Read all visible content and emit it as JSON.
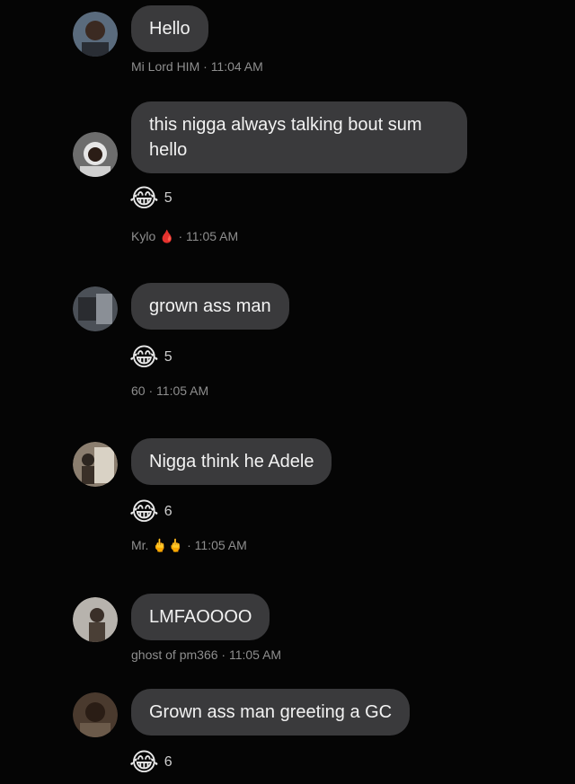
{
  "messages": [
    {
      "text": "Hello",
      "sender": "Mi Lord HIM",
      "time": "11:04 AM"
    },
    {
      "text": "this nigga always talking bout sum\nhello",
      "sender": "Kylo",
      "sender_emoji": "🩸",
      "time": "11:05 AM",
      "reaction": {
        "emoji": "😂",
        "count": "5"
      }
    },
    {
      "text": "grown ass man",
      "sender": "60",
      "time": "11:05 AM",
      "reaction": {
        "emoji": "😂",
        "count": "5"
      }
    },
    {
      "text": "Nigga think he Adele",
      "sender": "Mr.",
      "sender_emoji": "🖕🖕",
      "time": "11:05 AM",
      "reaction": {
        "emoji": "😂",
        "count": "6"
      }
    },
    {
      "text": "LMFAOOOO",
      "sender": "ghost of pm366",
      "time": "11:05 AM"
    },
    {
      "text": "Grown ass man greeting a GC",
      "reaction": {
        "emoji": "😂",
        "count": "6"
      }
    }
  ],
  "time_separator": "·",
  "icons": {
    "avatar": "avatar-photo-icon",
    "reaction": "face-with-tears-of-joy-icon",
    "blood-drop": "drop-of-blood-icon",
    "middle-finger": "middle-finger-icon"
  }
}
